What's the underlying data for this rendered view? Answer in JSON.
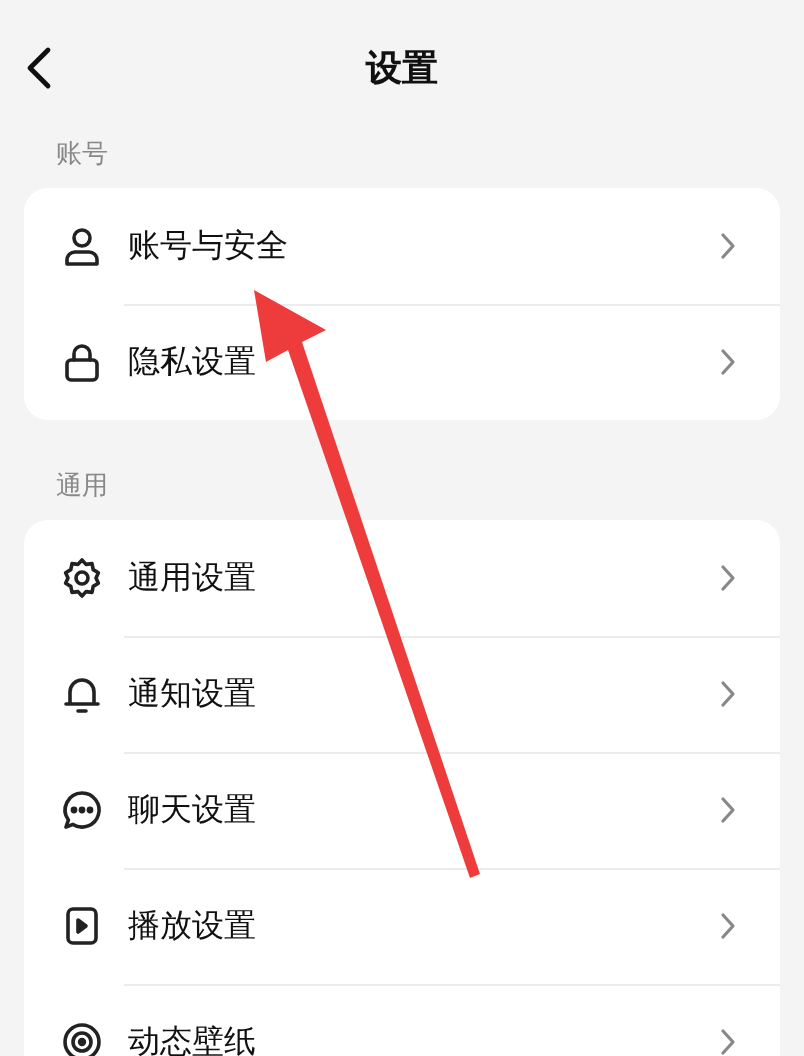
{
  "header": {
    "title": "设置"
  },
  "sections": [
    {
      "label": "账号",
      "items": [
        {
          "kind": "person",
          "label": "账号与安全"
        },
        {
          "kind": "lock",
          "label": "隐私设置"
        }
      ]
    },
    {
      "label": "通用",
      "items": [
        {
          "kind": "gear",
          "label": "通用设置"
        },
        {
          "kind": "bell",
          "label": "通知设置"
        },
        {
          "kind": "chat",
          "label": "聊天设置"
        },
        {
          "kind": "play",
          "label": "播放设置"
        },
        {
          "kind": "wallpaper",
          "label": "动态壁纸"
        }
      ]
    }
  ]
}
